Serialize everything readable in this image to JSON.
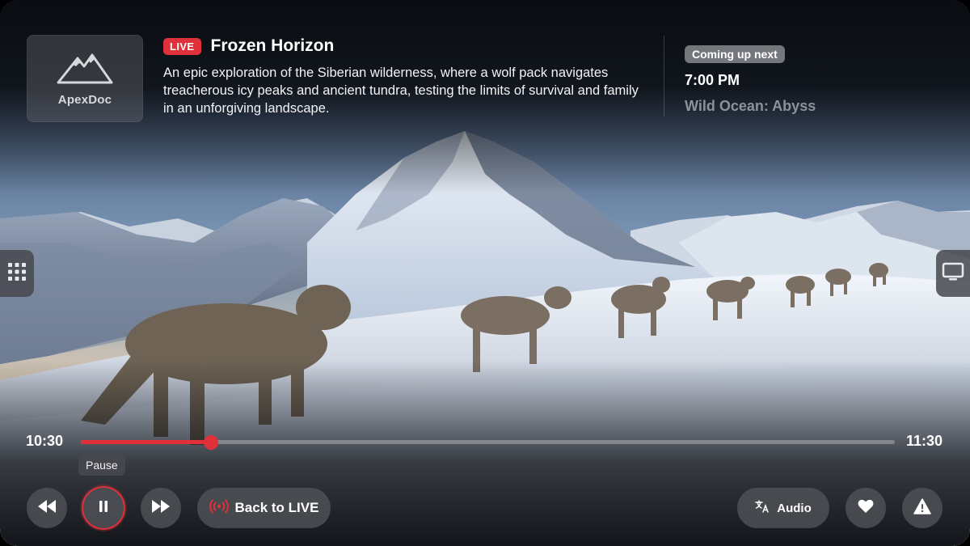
{
  "brand": {
    "name": "ApexDoc",
    "logo_icon": "mountain-icon"
  },
  "program": {
    "live_badge": "LIVE",
    "title": "Frozen Horizon",
    "description": "An epic exploration of the Siberian wilderness, where a wolf pack navigates treacherous icy peaks and ancient tundra, testing the limits of survival and family in an unforgiving landscape."
  },
  "next": {
    "label": "Coming up next",
    "time": "7:00 PM",
    "title": "Wild Ocean: Abyss"
  },
  "playback": {
    "start_time": "10:30",
    "end_time": "11:30",
    "progress": 0.16,
    "tooltip": "Pause"
  },
  "controls": {
    "back_to_live_label": "Back to LIVE",
    "audio_label": "Audio"
  },
  "colors": {
    "accent": "#e0303a",
    "button_bg": "#505258",
    "muted_text": "#8d929a"
  },
  "icons": {
    "rewind": "rewind-icon",
    "pause": "pause-icon",
    "fast_forward": "fast-forward-icon",
    "live": "broadcast-icon",
    "audio": "translate-icon",
    "favorite": "heart-icon",
    "report": "warning-icon",
    "apps": "grid-icon",
    "tv": "tv-icon"
  }
}
